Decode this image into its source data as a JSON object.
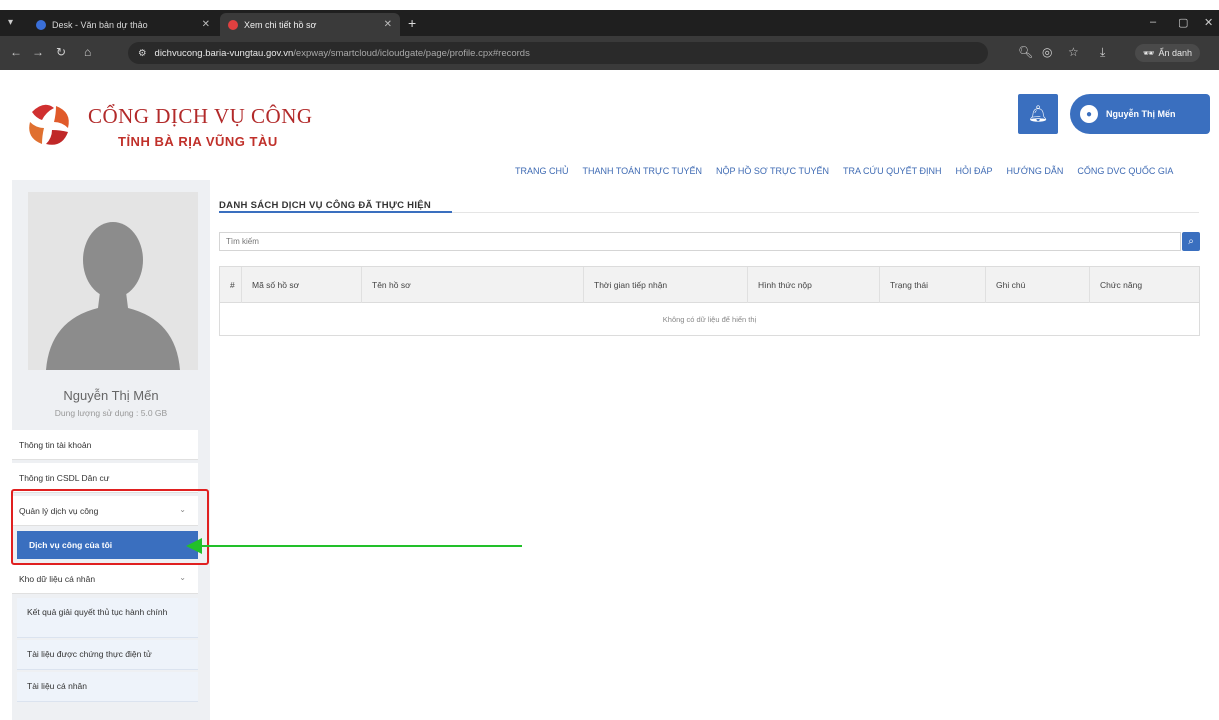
{
  "browser": {
    "tabs": [
      {
        "label": "Desk - Văn bản dự thảo",
        "active": false,
        "favicon_color": "#3a6fd8"
      },
      {
        "label": "Xem chi tiết hồ sơ",
        "active": true,
        "favicon_color": "#e04040"
      }
    ],
    "url_host": "dichvucong.baria-vungtau.gov.vn",
    "url_path": "/expway/smartcloud/icloudgate/page/profile.cpx#records",
    "incognito_label": "Ẩn danh"
  },
  "header": {
    "site_name": "CỔNG DỊCH VỤ CÔNG",
    "site_subtitle": "TỈNH BÀ RỊA VŨNG TÀU",
    "user_name": "Nguyễn Thị Mến",
    "nav": [
      "TRANG CHỦ",
      "THANH TOÁN TRỰC TUYẾN",
      "NỘP HỒ SƠ TRỰC TUYẾN",
      "TRA CỨU QUYẾT ĐỊNH",
      "HỎI ĐÁP",
      "HƯỚNG DẪN",
      "CỔNG DVC QUỐC GIA"
    ]
  },
  "sidebar": {
    "profile_name": "Nguyễn Thị Mến",
    "quota": "Dung lượng sử dụng : 5.0 GB",
    "items": [
      {
        "label": "Thông tin tài khoản"
      },
      {
        "label": "Thông tin CSDL Dân cư"
      },
      {
        "label": "Quản lý dịch vụ công"
      },
      {
        "label": "Dịch vụ công của tôi"
      },
      {
        "label": "Kho dữ liệu cá nhân"
      },
      {
        "label": "Kết quả giải quyết thủ tục hành chính"
      },
      {
        "label": "Tài liệu được chứng thực điện tử"
      },
      {
        "label": "Tài liệu cá nhân"
      }
    ]
  },
  "content": {
    "title": "DANH SÁCH DỊCH VỤ CÔNG ĐÃ THỰC HIỆN",
    "search_placeholder": "Tìm kiếm",
    "columns": [
      "#",
      "Mã số hồ sơ",
      "Tên hồ sơ",
      "Thời gian tiếp nhận",
      "Hình thức nộp",
      "Trạng thái",
      "Ghi chú",
      "Chức năng"
    ],
    "empty_text": "Không có dữ liệu để hiển thị"
  },
  "colors": {
    "accent": "#3a6fbf",
    "brand_red": "#b22a2a",
    "annotation_box": "#e02020",
    "annotation_arrow": "#22c02a"
  }
}
